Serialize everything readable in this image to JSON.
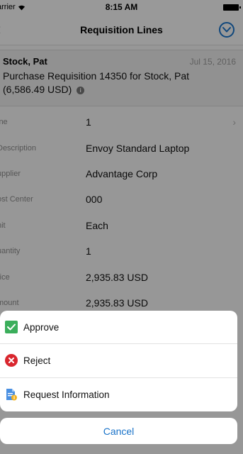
{
  "status_bar": {
    "carrier": "arrier",
    "time": "8:15 AM"
  },
  "nav": {
    "title": "Requisition Lines"
  },
  "header": {
    "name": "Stock, Pat",
    "date": "Jul 15, 2016",
    "description_line1": "Purchase Requisition 14350 for Stock, Pat",
    "description_line2": "(6,586.49 USD)",
    "info_icon_glyph": "i"
  },
  "details": [
    {
      "label": "ine",
      "value": "1"
    },
    {
      "label": "Description",
      "value": "Envoy Standard Laptop"
    },
    {
      "label": "upplier",
      "value": "Advantage Corp"
    },
    {
      "label": "ost Center",
      "value": "000"
    },
    {
      "label": "nit",
      "value": "Each"
    },
    {
      "label": "uantity",
      "value": "1"
    },
    {
      "label": "rice",
      "value": "2,935.83 USD"
    },
    {
      "label": "mount",
      "value": "2,935.83 USD"
    }
  ],
  "action_sheet": {
    "approve_label": "Approve",
    "reject_label": "Reject",
    "request_info_label": "Request Information",
    "cancel_label": "Cancel"
  },
  "colors": {
    "accent": "#1a73c9",
    "approve": "#3bae5b",
    "reject": "#d9262e",
    "request_info": "#4a90e2"
  },
  "icons": {
    "back": "chevron-left-icon",
    "menu": "dropdown-circle-icon",
    "approve": "check-icon",
    "reject": "x-circle-icon",
    "request_info": "document-info-icon",
    "row_chevron": "chevron-right-icon",
    "wifi": "wifi-icon",
    "battery": "battery-icon"
  }
}
